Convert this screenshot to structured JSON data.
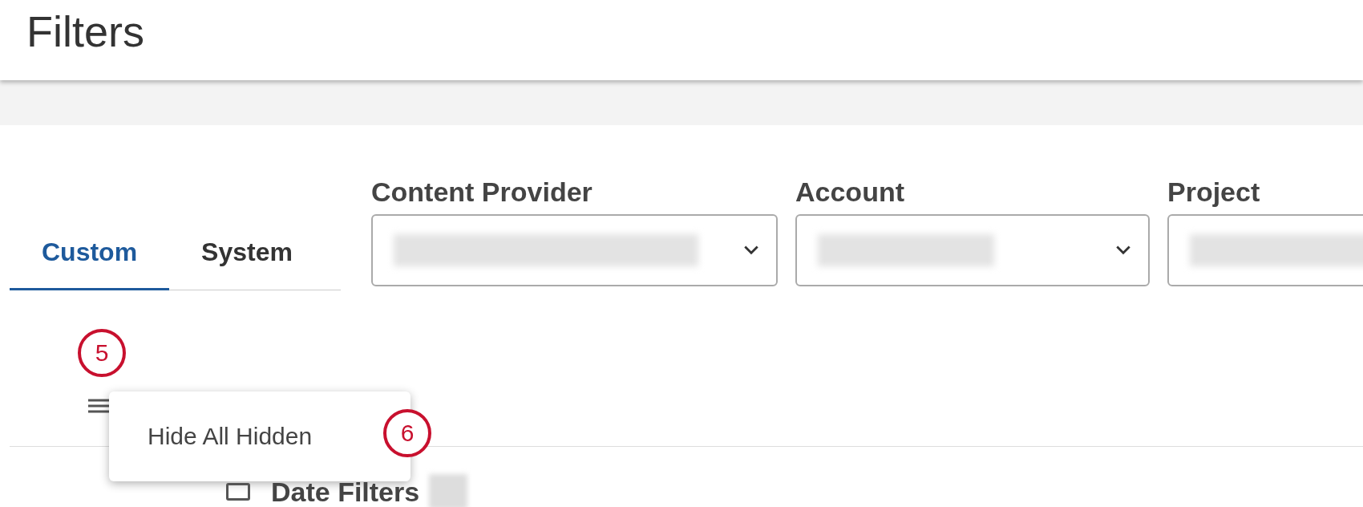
{
  "window": {
    "title": "Filters"
  },
  "tabs": [
    {
      "label": "Custom",
      "selected": true
    },
    {
      "label": "System",
      "selected": false
    }
  ],
  "dropdowns": [
    {
      "label": "Content Provider"
    },
    {
      "label": "Account"
    },
    {
      "label": "Project"
    }
  ],
  "menu": {
    "items": [
      {
        "label": "Hide All Hidden"
      }
    ]
  },
  "callouts": [
    "5",
    "6"
  ],
  "filter_groups": [
    {
      "label": "Date Filters",
      "checked": false
    }
  ]
}
